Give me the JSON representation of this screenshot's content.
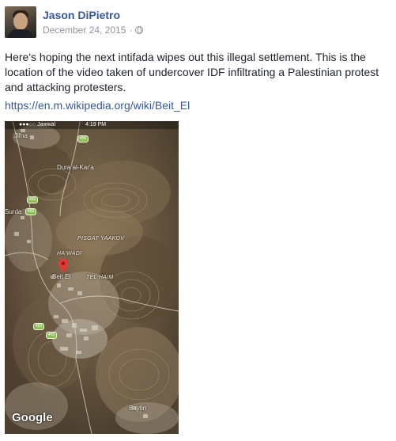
{
  "post": {
    "author": "Jason DiPietro",
    "date": "December 24, 2015",
    "separator": "·",
    "text": "Here's hoping the next intifada wipes out this illegal settlement. This is the location of the video taken of undercover IDF infiltrating a Palestinian protest and attacking protesters.",
    "link": "https://en.m.wikipedia.org/wiki/Beit_El"
  },
  "map": {
    "status_left": "●●●○○ Jawwal",
    "status_time": "4:19 PM",
    "labels": {
      "jifna": "Jifna",
      "dura": "Dura al-Kar'a",
      "surda": "Surda",
      "pisgat": "PISGAT YAAKOV",
      "hawadi": "HA'WADI",
      "beitel": "Beit El",
      "telhaim": "TEL HAIM",
      "baytin": "Baytin"
    },
    "routes": {
      "r1": "466",
      "r2": "466",
      "r3": "466",
      "r4": "463",
      "r5": "466"
    },
    "attribution": "Google"
  }
}
